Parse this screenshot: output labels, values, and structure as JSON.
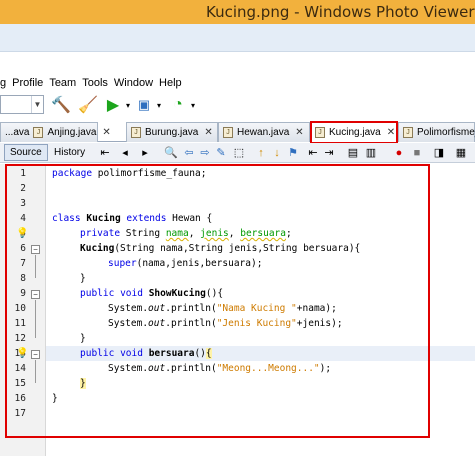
{
  "window": {
    "title": "Kucing.png - Windows Photo Viewer"
  },
  "menu": [
    "g",
    "Profile",
    "Team",
    "Tools",
    "Window",
    "Help"
  ],
  "toolbar": {
    "icons": [
      "hammer-icon",
      "clean-build-icon",
      "run-icon",
      "debug-icon",
      "profile-icon"
    ]
  },
  "tabs": [
    {
      "label": "...ava"
    },
    {
      "label": "Anjing.java"
    },
    {
      "label": "Burung.java"
    },
    {
      "label": "Hewan.java"
    },
    {
      "label": "Kucing.java",
      "active": true
    },
    {
      "label": "Polimorfisme_F"
    }
  ],
  "tab_close": "✕",
  "editor_bar": {
    "source": "Source",
    "history": "History"
  },
  "editor": {
    "line_numbers": [
      "1",
      "2",
      "3",
      "4",
      "5",
      "6",
      "7",
      "8",
      "9",
      "10",
      "11",
      "12",
      "13",
      "14",
      "15",
      "16",
      "17"
    ],
    "code": {
      "l1_kw": "package",
      "l1_rest": " polimorfisme_fauna;",
      "l4_kw1": "class",
      "l4_name": "Kucing",
      "l4_kw2": "extends",
      "l4_parent": " Hewan {",
      "l5_kw": "private",
      "l5_type": " String ",
      "l5_f1": "nama",
      "l5_f2": "jenis",
      "l5_f3": "bersuara",
      "l5_end": ";",
      "l6_name": "Kucing",
      "l6_rest": "(String nama,String jenis,String bersuara){",
      "l7_kw": "super",
      "l7_rest": "(nama,jenis,bersuara);",
      "l8": "}",
      "l9_kw1": "public",
      "l9_kw2": "void",
      "l9_name": "ShowKucing",
      "l9_rest": "(){",
      "l10_pre": "System.",
      "l10_out": "out",
      "l10_mid": ".println(",
      "l10_str": "\"Nama Kucing \"",
      "l10_end": "+nama);",
      "l11_pre": "System.",
      "l11_out": "out",
      "l11_mid": ".println(",
      "l11_str": "\"Jenis Kucing\"",
      "l11_end": "+jenis);",
      "l12": "}",
      "l13_kw1": "public",
      "l13_kw2": "void",
      "l13_name": "bersuara",
      "l13_paren": "()",
      "l13_brace": "{",
      "l14_pre": "System.",
      "l14_out": "out",
      "l14_mid": ".println(",
      "l14_str": "\"Meong...Meong...\"",
      "l14_end": ");",
      "l15": "}",
      "l16": "}"
    }
  },
  "colors": {
    "highlight": "#e00000",
    "keyword": "#0000e6",
    "field": "#009900",
    "string": "#ce7b00"
  }
}
